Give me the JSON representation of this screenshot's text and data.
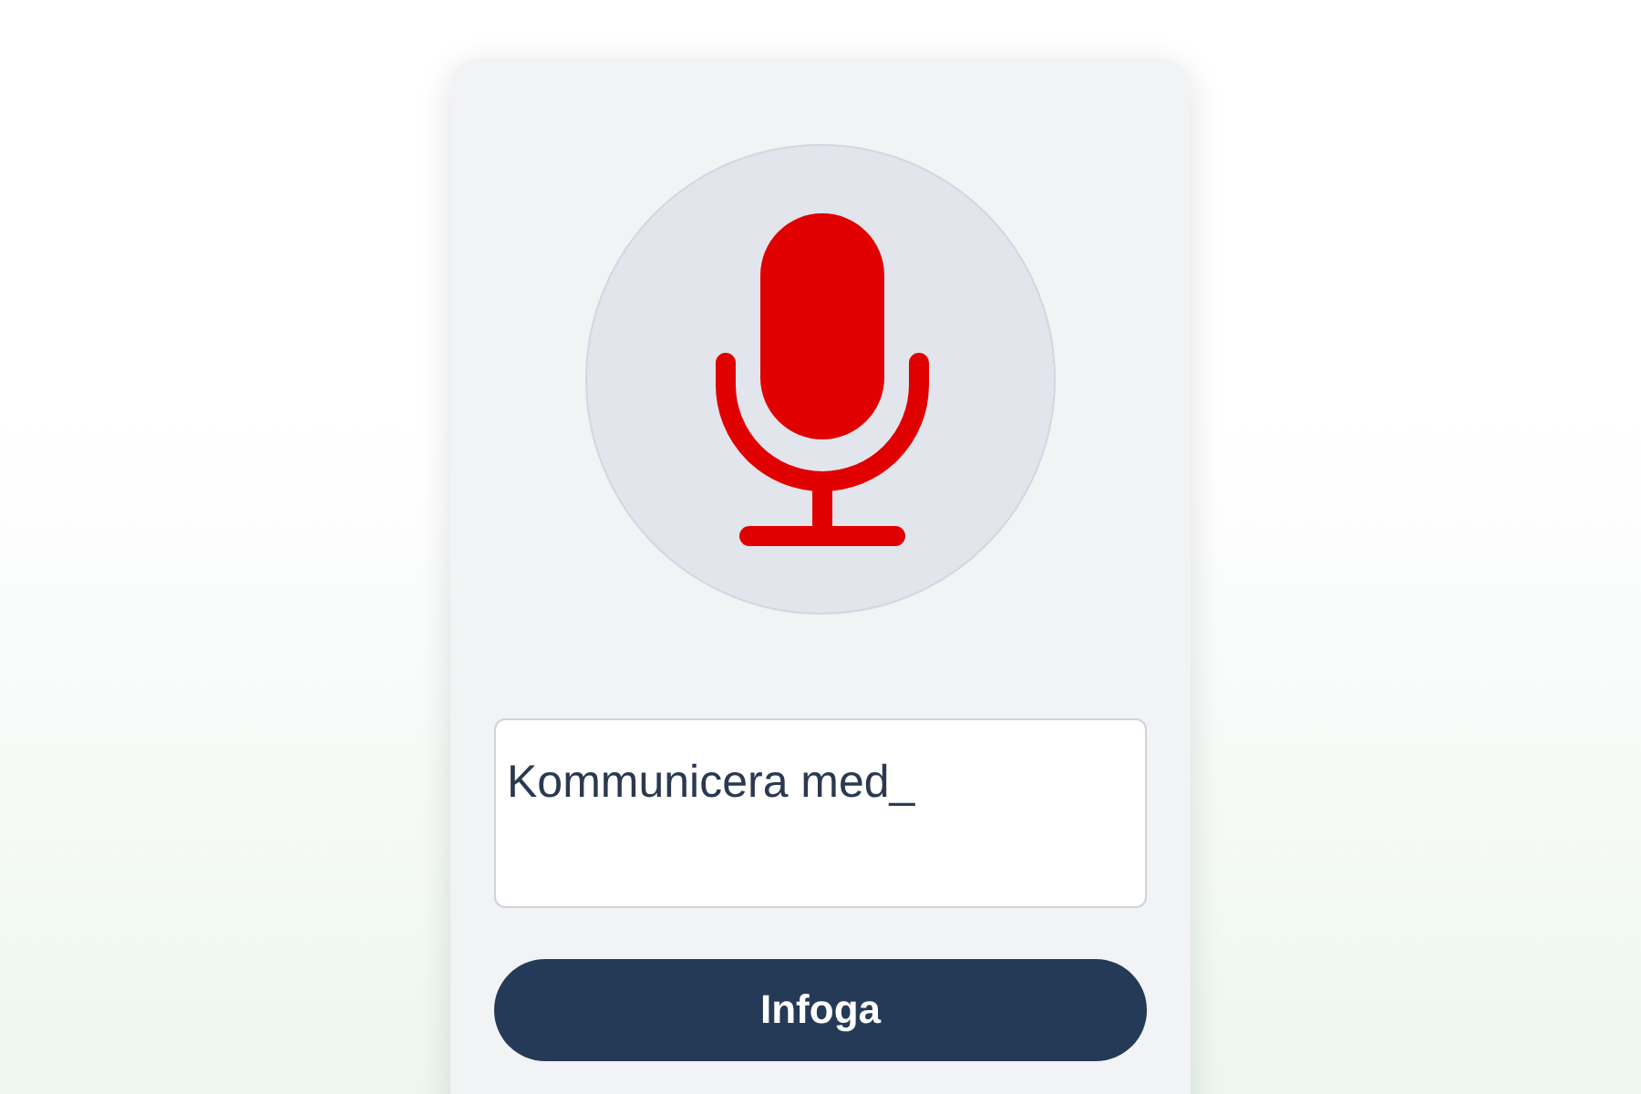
{
  "dictation": {
    "text": "Kommunicera med_"
  },
  "button": {
    "label": "Infoga"
  }
}
